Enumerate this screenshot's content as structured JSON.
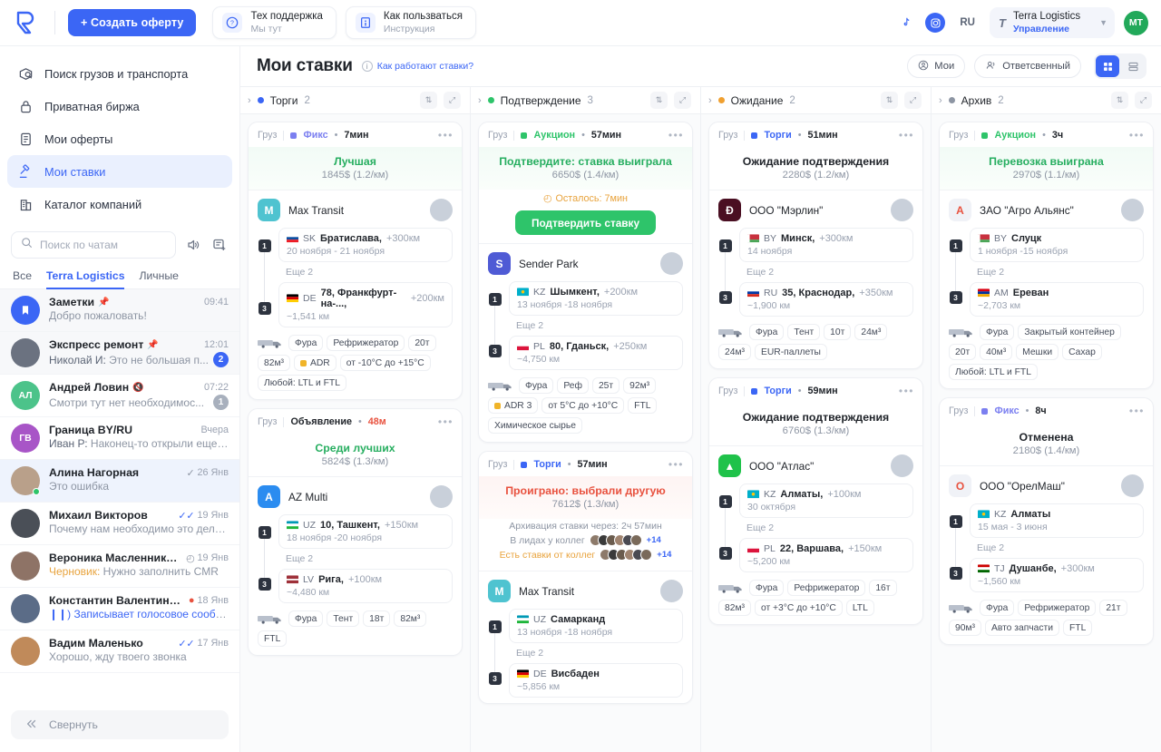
{
  "topbar": {
    "logo_name": "cargo-platform-logo",
    "create_button": "+ Создать оферту",
    "support": {
      "title": "Тех поддержка",
      "subtitle": "Мы тут",
      "icon": "question-chat-icon"
    },
    "howto": {
      "title": "Как пользваться",
      "subtitle": "Инструкция",
      "icon": "book-info-icon"
    },
    "tiktok_icon": "tiktok-icon",
    "instagram_icon": "instagram-icon",
    "language": "RU",
    "org": {
      "name": "Terra Logistics",
      "role": "Управление",
      "icon": "terra-logo-icon"
    },
    "user_initials": "MT",
    "accent": "#3b66f5"
  },
  "sidebar": {
    "nav": [
      {
        "label": "Поиск грузов и транспорта",
        "icon": "search-cargo-icon",
        "active": false
      },
      {
        "label": "Приватная биржа",
        "icon": "lock-icon",
        "active": false
      },
      {
        "label": "Мои оферты",
        "icon": "document-icon",
        "active": false
      },
      {
        "label": "Мои ставки",
        "icon": "gavel-icon",
        "active": true
      },
      {
        "label": "Каталог компаний",
        "icon": "building-icon",
        "active": false
      }
    ],
    "search_placeholder": "Поиск по чатам",
    "search_value": "",
    "sound_icon": "speaker-icon",
    "new_chat_icon": "new-chat-icon",
    "tabs": [
      {
        "label": "Все",
        "active": false
      },
      {
        "label": "Terra Logistics",
        "active": true
      },
      {
        "label": "Личные",
        "active": false
      }
    ],
    "chats": [
      {
        "name": "Заметки",
        "pinned": true,
        "time": "09:41",
        "message": "Добро пожаловать!",
        "avatar_color": "#3b66f5",
        "avatar_text": "",
        "avatar_icon": "bookmark-icon",
        "badge": "",
        "state": "gray"
      },
      {
        "name": "Экспресс ремонт",
        "pinned": true,
        "time": "12:01",
        "sender": "Николай И:",
        "message": "Это не большая п...",
        "avatar_color": "#6b7280",
        "avatar_text": "",
        "badge": "2",
        "badge_type": "blue",
        "state": "gray"
      },
      {
        "name": "Андрей Ловин",
        "muted": true,
        "time": "07:22",
        "message": "Смотри тут нет необходимос...",
        "avatar_color": "#4cc38a",
        "avatar_text": "АЛ",
        "badge": "1",
        "badge_type": "mute",
        "state": ""
      },
      {
        "name": "Граница BY/RU",
        "time": "Вчера",
        "sender": "Иван Р:",
        "message": "Наконец-то открыли еще ...",
        "avatar_color": "#a855c7",
        "avatar_text": "ГВ",
        "badge": "",
        "state": ""
      },
      {
        "name": "Алина Нагорная",
        "time": "26 Янв",
        "check": "single",
        "message": "Это ошибка",
        "avatar_color": "#b9a08a",
        "avatar_text": "",
        "online": true,
        "badge": "",
        "state": "sel"
      },
      {
        "name": "Михаил Викторов",
        "time": "19 Янв",
        "check": "double",
        "message": "Почему нам необходимо это делать",
        "avatar_color": "#4a4f57",
        "avatar_text": "",
        "badge": "",
        "state": ""
      },
      {
        "name": "Вероника Масленникова",
        "time": "19 Янв",
        "clock": true,
        "draft": "Черновик:",
        "message": "Нужно заполнить CMR",
        "avatar_color": "#8e7366",
        "avatar_text": "",
        "badge": "",
        "state": ""
      },
      {
        "name": "Константин Валентинови...",
        "time": "18 Янв",
        "alert": true,
        "voice": "Записывает голосовое сообще...",
        "message": "",
        "avatar_color": "#5b6c87",
        "avatar_text": "",
        "badge": "",
        "state": ""
      },
      {
        "name": "Вадим Маленько",
        "time": "17 Янв",
        "check": "double",
        "message": "Хорошо, жду твоего звонка",
        "avatar_color": "#c08a5a",
        "avatar_text": "",
        "badge": "",
        "state": ""
      }
    ],
    "collapse_label": "Свернуть",
    "collapse_icon": "double-chevron-left-icon"
  },
  "page": {
    "title": "Мои ставки",
    "help_link": "Как работают ставки?",
    "filters": [
      {
        "label": "Мои",
        "icon": "user-circle-icon"
      },
      {
        "label": "Ответсвенный",
        "icon": "users-icon"
      }
    ],
    "views": [
      {
        "icon": "grid-view-icon",
        "active": true
      },
      {
        "icon": "list-view-icon",
        "active": false
      }
    ]
  },
  "board": {
    "columns": [
      {
        "name": "Торги",
        "count": "2",
        "dot": "#3b66f5",
        "cards": [
          {
            "kind": "Груз",
            "type": "Фикс",
            "type_color": "#7b7ff0",
            "time": "7мин",
            "time_warn": false,
            "status": {
              "title": "Лучшая",
              "style": "g",
              "band": "green",
              "price": "1845$ (1.2/км)"
            },
            "company": {
              "name": "Max Transit",
              "logo_bg": "#4fc3d0",
              "logo_text": "M",
              "logo_icon": "max-transit-logo"
            },
            "stops": [
              {
                "cc": "SK",
                "flag": "sk",
                "city": "Братислава,",
                "extra": "+300км",
                "sub": "20 ноября - 21 ноября"
              },
              {
                "cc": "DE",
                "flag": "de",
                "city": "78, Франкфурт-на-...,",
                "extra": "+200км",
                "sub": "~1,541  км"
              }
            ],
            "more": "Еще 2",
            "tags": [
              "truck-icon",
              "Фура",
              "Рефрижератор",
              "20т",
              "82м³",
              "adr:ADR",
              "от -10°C до +15°C",
              "Любой: LTL и FTL"
            ]
          },
          {
            "kind": "Груз",
            "type": "Объявление",
            "type_color": "",
            "time": "48м",
            "time_warn": true,
            "status": {
              "title": "Среди лучших",
              "style": "g",
              "band": "plain",
              "price": "5824$ (1.3/км)"
            },
            "company": {
              "name": "AZ Multi",
              "logo_bg": "#2b8cf0",
              "logo_text": "A",
              "logo_icon": "az-multi-logo"
            },
            "stops": [
              {
                "cc": "UZ",
                "flag": "uz",
                "city": "10, Ташкент,",
                "extra": "+150км",
                "sub": "18 ноября -20 ноября"
              },
              {
                "cc": "LV",
                "flag": "lv",
                "city": "Рига,",
                "extra": "+100км",
                "sub": "~4,480 км"
              }
            ],
            "more": "Еще 2",
            "tags": [
              "truck-icon",
              "Фура",
              "Тент",
              "18т",
              "82м³",
              "FTL"
            ]
          }
        ]
      },
      {
        "name": "Подтверждение",
        "count": "3",
        "dot": "#2ec46a",
        "cards": [
          {
            "kind": "Груз",
            "type": "Аукцион",
            "type_color": "#2ec46a",
            "time": "57мин",
            "time_warn": false,
            "status": {
              "title": "Подтвердите: ставка выиграла",
              "style": "g",
              "band": "green",
              "price": "6650$ (1.4/км)"
            },
            "timer": "Осталось: 7мин",
            "confirm_button": "Подтвердить ставку",
            "company": {
              "name": "Sender Park",
              "logo_bg": "#4f5bd5",
              "logo_text": "S",
              "logo_icon": "sender-park-logo"
            },
            "stops": [
              {
                "cc": "KZ",
                "flag": "kz",
                "city": "Шымкент,",
                "extra": "+200км",
                "sub": "13 ноября -18 ноября"
              },
              {
                "cc": "PL",
                "flag": "pl",
                "city": "80, Гданьск,",
                "extra": "+250км",
                "sub": "~4,750 км"
              }
            ],
            "more": "Еще 2",
            "tags": [
              "truck-icon",
              "Фура",
              "Реф",
              "25т",
              "92м³",
              "adr:ADR 3",
              "от 5°C до +10°C",
              "FTL",
              "Химическое сырье"
            ]
          },
          {
            "kind": "Груз",
            "type": "Торги",
            "type_color": "#3b66f5",
            "time": "57мин",
            "time_warn": false,
            "status": {
              "title": "Проиграно: выбрали другую",
              "style": "r",
              "band": "red",
              "price": "7612$ (1.3/км)"
            },
            "meta": [
              {
                "text": "Архивация ставки через: 2ч 57мин",
                "style": ""
              },
              {
                "text": "В лидах у коллег",
                "style": "",
                "avatars": 6,
                "plus": "+14"
              },
              {
                "text": "Есть ставки от коллег",
                "style": "orange",
                "avatars": 6,
                "plus": "+14"
              }
            ],
            "company": {
              "name": "Max Transit",
              "logo_bg": "#4fc3d0",
              "logo_text": "M",
              "logo_icon": "max-transit-logo"
            },
            "stops": [
              {
                "cc": "UZ",
                "flag": "uz",
                "city": "Самарканд",
                "extra": "",
                "sub": "13 ноября -18 ноября"
              },
              {
                "cc": "DE",
                "flag": "de",
                "city": "Висбаден",
                "extra": "",
                "sub": "~5,856 км"
              }
            ],
            "more": "Еще 2",
            "tags": []
          }
        ]
      },
      {
        "name": "Ожидание",
        "count": "2",
        "dot": "#f0a030",
        "cards": [
          {
            "kind": "Груз",
            "type": "Торги",
            "type_color": "#3b66f5",
            "time": "51мин",
            "time_warn": false,
            "status": {
              "title": "Ожидание подтверждения",
              "style": "b",
              "band": "plain",
              "price": "2280$ (1.2/км)"
            },
            "company": {
              "name": "ООО \"Мэрлин\"",
              "logo_bg": "#4a0f22",
              "logo_text": "Ð",
              "logo_icon": "merlin-logo"
            },
            "stops": [
              {
                "cc": "BY",
                "flag": "by",
                "city": "Минск,",
                "extra": "+300км",
                "sub": "14 ноября"
              },
              {
                "cc": "RU",
                "flag": "ru",
                "city": "35, Краснодар,",
                "extra": "+350км",
                "sub": "~1,900 км"
              }
            ],
            "more": "Еще 2",
            "tags": [
              "truck-icon",
              "Фура",
              "Тент",
              "10т",
              "24м³",
              "24м³",
              "EUR-паллеты"
            ]
          },
          {
            "kind": "Груз",
            "type": "Торги",
            "type_color": "#3b66f5",
            "time": "59мин",
            "time_warn": false,
            "status": {
              "title": "Ожидание подтверждения",
              "style": "b",
              "band": "plain",
              "price": "6760$ (1.3/км)"
            },
            "company": {
              "name": "ООО \"Атлас\"",
              "logo_bg": "#1fc24a",
              "logo_text": "▲",
              "logo_icon": "atlas-logo"
            },
            "stops": [
              {
                "cc": "KZ",
                "flag": "kz",
                "city": "Алматы,",
                "extra": "+100км",
                "sub": "30 октября"
              },
              {
                "cc": "PL",
                "flag": "pl",
                "city": "22, Варшава,",
                "extra": "+150км",
                "sub": "~5,200 км"
              }
            ],
            "more": "Еще 2",
            "tags": [
              "truck-icon",
              "Фура",
              "Рефрижератор",
              "16т",
              "82м³",
              "от +3°C до +10°C",
              "LTL"
            ]
          }
        ]
      },
      {
        "name": "Архив",
        "count": "2",
        "dot": "#8d95a3",
        "cards": [
          {
            "kind": "Груз",
            "type": "Аукцион",
            "type_color": "#2ec46a",
            "time": "3ч",
            "time_warn": false,
            "status": {
              "title": "Перевозка выиграна",
              "style": "g",
              "band": "green",
              "price": "2970$ (1.1/км)"
            },
            "company": {
              "name": "ЗАО \"Агро Альянс\"",
              "logo_bg": "#f0f2f7",
              "logo_text": "A",
              "logo_icon": "agro-alliance-logo"
            },
            "stops": [
              {
                "cc": "BY",
                "flag": "by",
                "city": "Слуцк",
                "extra": "",
                "sub": "1 ноября -15 ноября"
              },
              {
                "cc": "AM",
                "flag": "am",
                "city": "Ереван",
                "extra": "",
                "sub": "~2,703 км"
              }
            ],
            "more": "Еще 2",
            "tags": [
              "truck-icon",
              "Фура",
              "Закрытый контейнер",
              "20т",
              "40м³",
              "Мешки",
              "Сахар",
              "Любой: LTL и FTL"
            ]
          },
          {
            "kind": "Груз",
            "type": "Фикс",
            "type_color": "#7b7ff0",
            "time": "8ч",
            "time_warn": false,
            "status": {
              "title": "Отменена",
              "style": "b",
              "band": "plain",
              "price": "2180$ (1.4/км)"
            },
            "company": {
              "name": "ООО \"ОрелМаш\"",
              "logo_bg": "#f0f2f7",
              "logo_text": "O",
              "logo_icon": "orelmash-logo"
            },
            "stops": [
              {
                "cc": "KZ",
                "flag": "kz",
                "city": "Алматы",
                "extra": "",
                "sub": "15 мая - 3 июня"
              },
              {
                "cc": "TJ",
                "flag": "tj",
                "city": "Душанбе,",
                "extra": "+300км",
                "sub": "~1,560 км"
              }
            ],
            "more": "Еще 2",
            "tags": [
              "truck-icon",
              "Фура",
              "Рефрижератор",
              "21т",
              "90м³",
              "Авто запчасти",
              "FTL"
            ]
          }
        ]
      }
    ]
  }
}
